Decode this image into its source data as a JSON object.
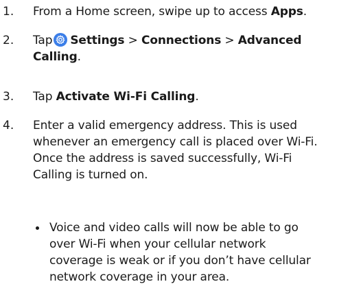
{
  "steps": [
    {
      "number": "1.",
      "text_before": "From a Home screen, swipe up to access ",
      "bold": "Apps",
      "text_after": "."
    },
    {
      "number": "2.",
      "tap": "Tap",
      "icon": "settings-gear-icon",
      "icon_color": "#3b7ee8",
      "bold_a": "Settings",
      "sep1": " > ",
      "bold_b": "Connections",
      "sep2": " > ",
      "bold_c1": "Advanced",
      "bold_c2": "Calling",
      "end": "."
    },
    {
      "number": "3.",
      "tap": "Tap ",
      "bold": "Activate Wi-Fi Calling",
      "end": "."
    },
    {
      "number": "4.",
      "lines": [
        "Enter a valid emergency address. This is used",
        "whenever an emergency call is placed over Wi-Fi.",
        "Once the address is saved successfully, Wi-Fi",
        "Calling is turned on."
      ]
    }
  ],
  "bullet": {
    "lines": [
      "Voice and video calls will now be able to go",
      "over Wi-Fi when your cellular network",
      "coverage is weak or if you don’t have cellular",
      "network coverage in your area."
    ]
  }
}
